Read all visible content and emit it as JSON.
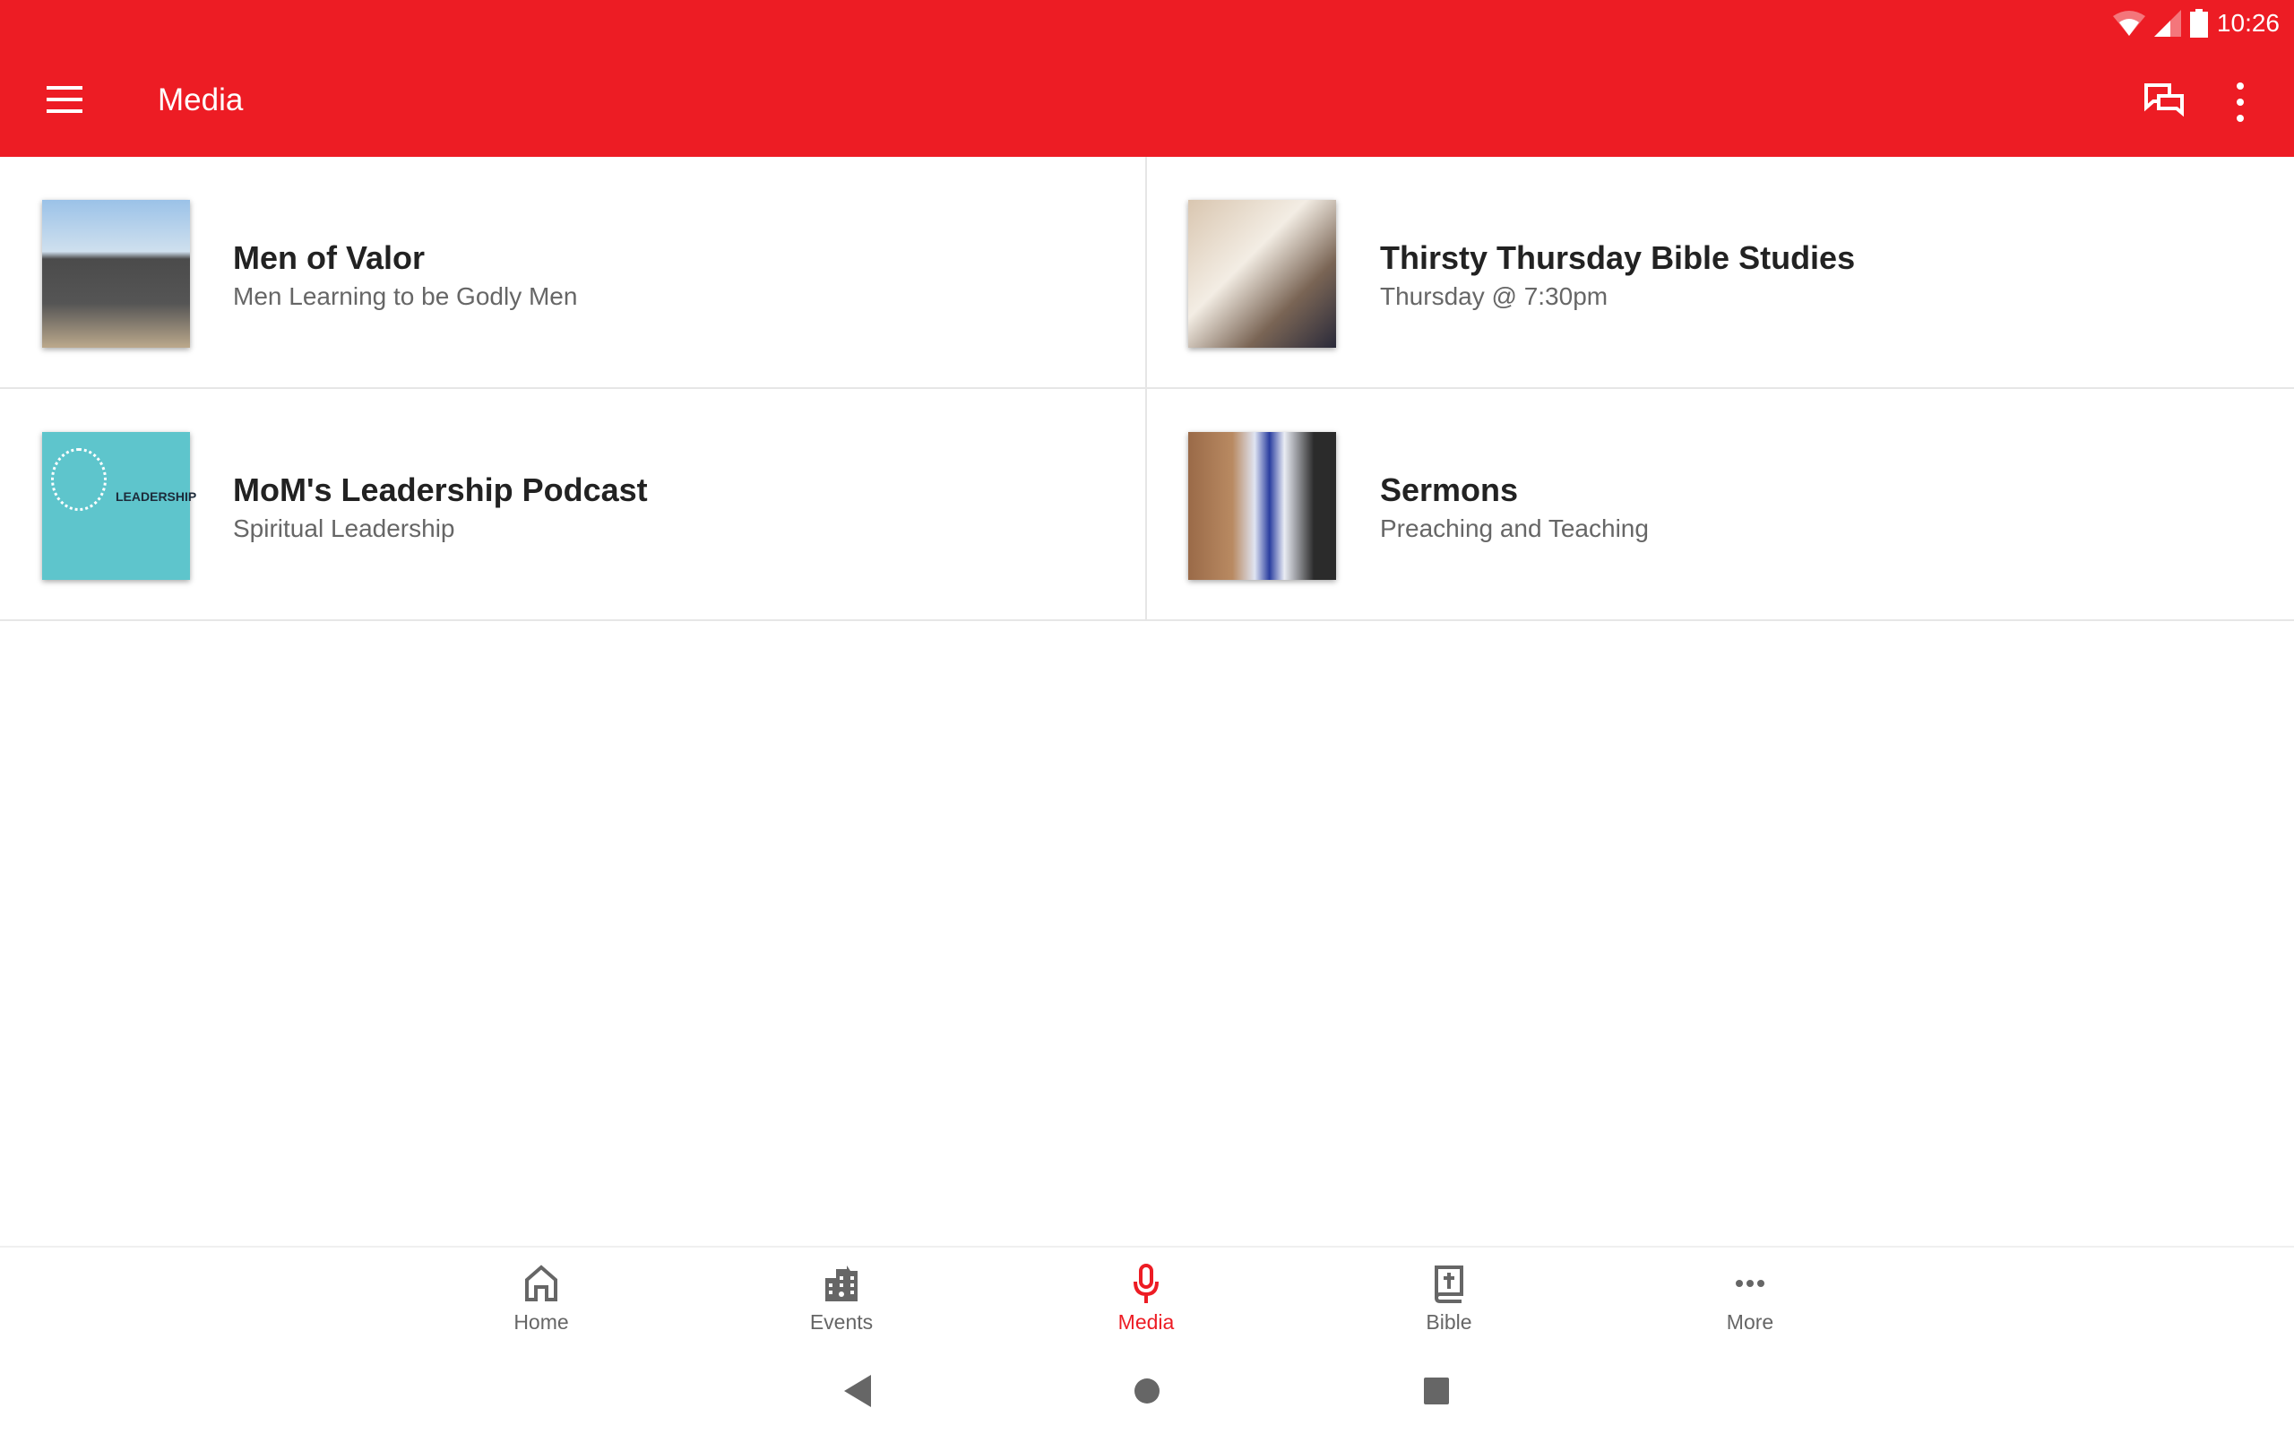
{
  "status_bar": {
    "time": "10:26",
    "icons": [
      "wifi-icon",
      "signal-icon",
      "battery-icon"
    ]
  },
  "app_bar": {
    "title": "Media",
    "icons": [
      "menu-icon",
      "chat-icon",
      "more-vert-icon"
    ]
  },
  "accent_color": "#ed1c24",
  "items": [
    {
      "title": "Men of Valor",
      "subtitle": "Men Learning to be Godly Men"
    },
    {
      "title": "Thirsty Thursday Bible Studies",
      "subtitle": "Thursday @ 7:30pm"
    },
    {
      "title": "MoM's Leadership Podcast",
      "subtitle": "Spiritual Leadership",
      "thumb_text": "LEADERSHIP"
    },
    {
      "title": "Sermons",
      "subtitle": "Preaching and Teaching"
    }
  ],
  "bottom_nav": [
    {
      "label": "Home",
      "icon": "home-icon"
    },
    {
      "label": "Events",
      "icon": "building-icon"
    },
    {
      "label": "Media",
      "icon": "microphone-icon",
      "active": true
    },
    {
      "label": "Bible",
      "icon": "bible-icon"
    },
    {
      "label": "More",
      "icon": "more-horiz-icon"
    }
  ]
}
